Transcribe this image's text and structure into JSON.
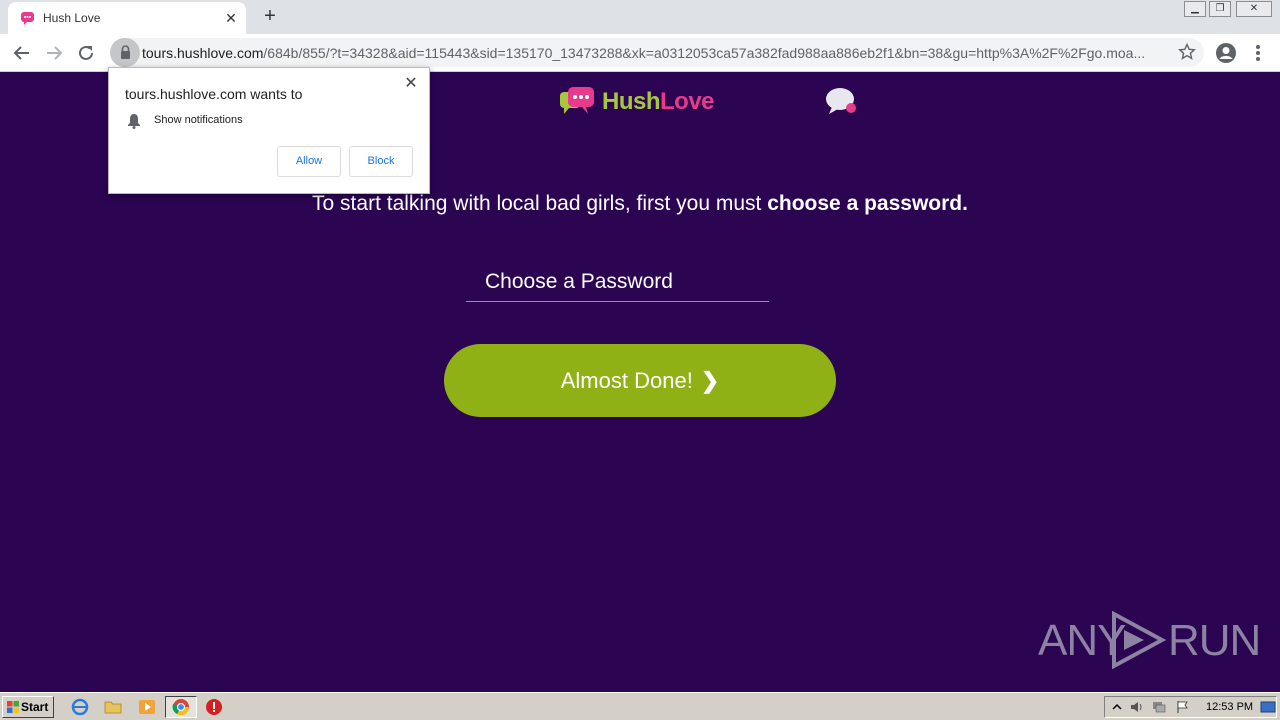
{
  "browser": {
    "tab_title": "Hush Love",
    "tab_close": "✕",
    "new_tab": "+",
    "url_host": "tours.hushlove.com",
    "url_path": "/684b/855/?t=34328&aid=115443&sid=135170_13473288&xk=a0312053ca57a382fad988aa886eb2f1&bn=38&gu=http%3A%2F%2Fgo.moa..."
  },
  "notification_prompt": {
    "title": "tours.hushlove.com wants to",
    "permission": "Show notifications",
    "allow_label": "Allow",
    "block_label": "Block",
    "close": "✕"
  },
  "page": {
    "logo_hush": "Hush",
    "logo_love": "Love",
    "headline_regular": "To start talking with local bad girls, first you must ",
    "headline_bold": "choose a password.",
    "password_placeholder": "Choose a Password",
    "cta_label": "Almost Done!",
    "cta_chevron": "❯",
    "colors": {
      "background": "#2b0452",
      "cta": "#8fb116",
      "brand_pink": "#e83a8c",
      "brand_green": "#a7c83d"
    }
  },
  "watermark": {
    "left": "ANY",
    "right": "RUN"
  },
  "taskbar": {
    "start_label": "Start",
    "clock": "12:53 PM"
  },
  "icons": [
    "back-icon",
    "forward-icon",
    "reload-icon",
    "lock-icon",
    "star-icon",
    "profile-icon",
    "menu-icon",
    "bell-icon",
    "chat-icon",
    "ie-icon",
    "folder-icon",
    "media-player-icon",
    "chrome-icon",
    "stop-icon"
  ]
}
